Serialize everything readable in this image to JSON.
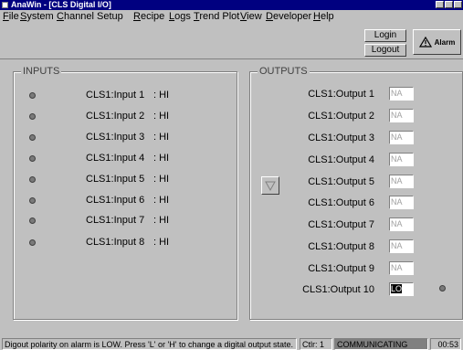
{
  "window": {
    "title": "AnaWin - [CLS Digital I/O]"
  },
  "menu": [
    "File",
    "System",
    "Channel Setup",
    "Recipe",
    "Logs",
    "Trend Plot",
    "View",
    "Developer",
    "Help"
  ],
  "toolbar": {
    "login_label": "Login",
    "logout_label": "Logout",
    "alarm_label": "Alarm"
  },
  "inputs": {
    "title": "INPUTS",
    "rows": [
      {
        "label": "CLS1:Input 1",
        "state": ": HI"
      },
      {
        "label": "CLS1:Input 2",
        "state": ": HI"
      },
      {
        "label": "CLS1:Input 3",
        "state": ": HI"
      },
      {
        "label": "CLS1:Input 4",
        "state": ": HI"
      },
      {
        "label": "CLS1:Input 5",
        "state": ": HI"
      },
      {
        "label": "CLS1:Input 6",
        "state": ": HI"
      },
      {
        "label": "CLS1:Input 7",
        "state": ": HI"
      },
      {
        "label": "CLS1:Input 8",
        "state": ": HI"
      }
    ]
  },
  "outputs": {
    "title": "OUTPUTS",
    "rows": [
      {
        "label": "CLS1:Output 1",
        "value": "NA"
      },
      {
        "label": "CLS1:Output 2",
        "value": "NA"
      },
      {
        "label": "CLS1:Output 3",
        "value": "NA"
      },
      {
        "label": "CLS1:Output 4",
        "value": "NA"
      },
      {
        "label": "CLS1:Output 5",
        "value": "NA"
      },
      {
        "label": "CLS1:Output 6",
        "value": "NA"
      },
      {
        "label": "CLS1:Output 7",
        "value": "NA"
      },
      {
        "label": "CLS1:Output 8",
        "value": "NA"
      },
      {
        "label": "CLS1:Output 9",
        "value": "NA"
      },
      {
        "label": "CLS1:Output 10",
        "value": "LO"
      }
    ]
  },
  "status": {
    "message": "Digout polarity on alarm is LOW.   Press 'L' or 'H' to change a digital output state.",
    "controller": "Ctlr: 1",
    "comm": "COMMUNICATING",
    "time": "00:53"
  }
}
